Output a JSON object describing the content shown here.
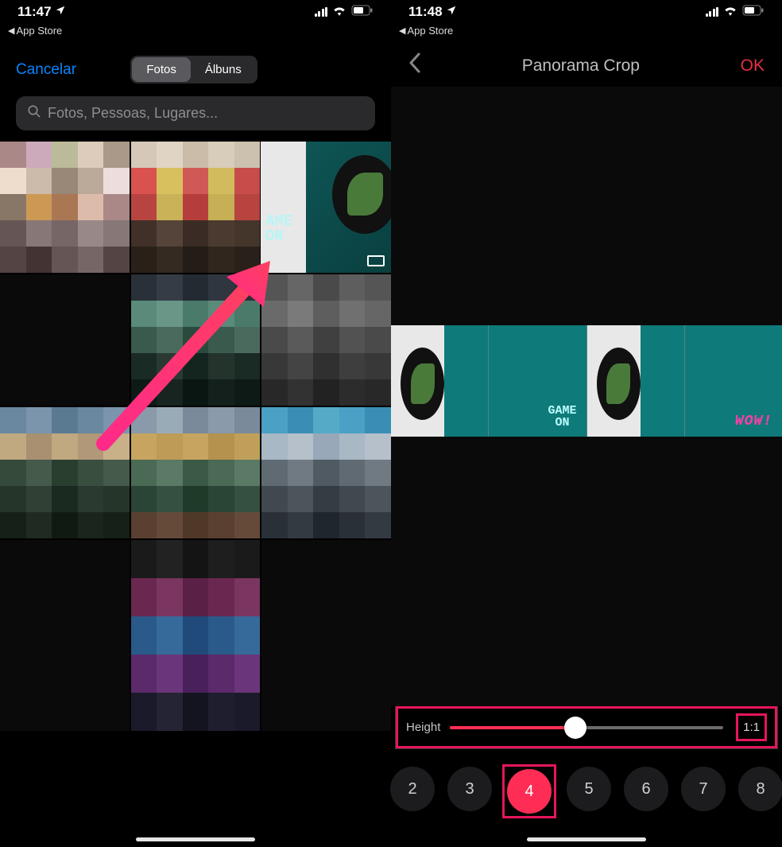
{
  "left": {
    "status": {
      "time": "11:47",
      "breadcrumb": "App Store"
    },
    "header": {
      "cancel": "Cancelar",
      "tabs": {
        "photos": "Fotos",
        "albums": "Álbuns",
        "active": "photos"
      }
    },
    "search": {
      "placeholder": "Fotos, Pessoas, Lugares..."
    },
    "panorama_tile": {
      "text_line1": "AME",
      "text_line2": "ON"
    }
  },
  "right": {
    "status": {
      "time": "11:48",
      "breadcrumb": "App Store"
    },
    "header": {
      "title": "Panorama Crop",
      "ok": "OK"
    },
    "strip": {
      "tile2_text": "GAME\nON",
      "tile4_text": "WOW!"
    },
    "height": {
      "label": "Height",
      "slider_pct": 46,
      "ratio": "1:1"
    },
    "counts": {
      "options": [
        "2",
        "3",
        "4",
        "5",
        "6",
        "7",
        "8"
      ],
      "active": "4"
    }
  }
}
